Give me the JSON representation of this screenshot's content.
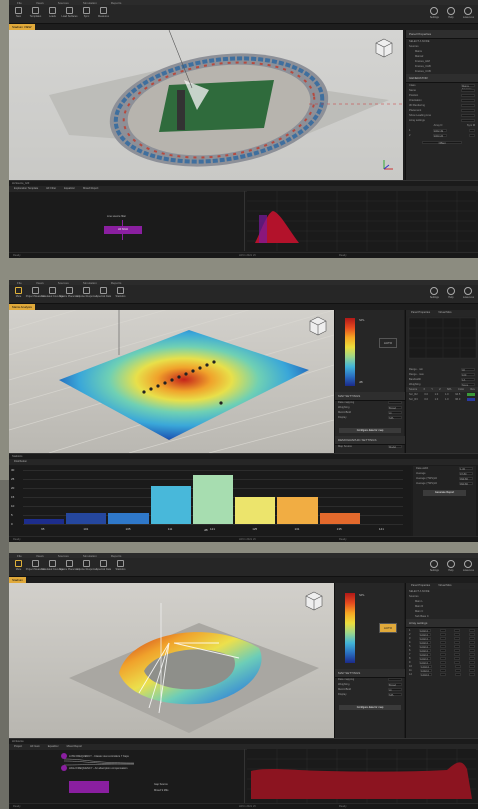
{
  "menu": [
    "File",
    "Views",
    "Sources",
    "Simulation",
    "Reports"
  ],
  "s1": {
    "ribbon": [
      "New",
      "Templates",
      "Loads",
      "Load Surfaces",
      "Sync",
      "Measures"
    ],
    "ribbon_right": [
      "Settings",
      "Help",
      "Lower-res"
    ],
    "viewport_tag": "Stadium VIEW",
    "panel_title": "Panel Properties",
    "props": {
      "group1": "SELECT A NODE",
      "sources": "Sources",
      "items": [
        "Mains",
        "Mains2",
        "Frames_HiM",
        "Frames_CHB",
        "Frames_CUB"
      ],
      "section": "GENERATOR",
      "rows": [
        {
          "label": "Class",
          "value": "Mains Sources"
        },
        {
          "label": "Name",
          "value": ""
        },
        {
          "label": "Position",
          "value": ""
        },
        {
          "label": "Orientation",
          "value": ""
        },
        {
          "label": "3D Rendering",
          "value": ""
        },
        {
          "label": "Placement",
          "value": ""
        },
        {
          "label": "Show Leading Line",
          "value": ""
        },
        {
          "label": "Array settings",
          "value": ""
        }
      ],
      "table_head": [
        "",
        "Array D",
        "Sym M"
      ],
      "table": [
        [
          "1",
          "1002.49",
          "",
          ""
        ],
        [
          "2",
          "1003.26",
          "",
          ""
        ]
      ],
      "foot": "Offset"
    },
    "bottom_tabs": [
      "Exploration Template",
      "HF Filter",
      "Equalizer",
      "Mixed Report"
    ],
    "subtitle": "Hi-Source_GIF",
    "source_label": "Line source filter",
    "purple_label": "HF 60Hz",
    "status_left": "Ready",
    "status_mid": "LRC1 2021 L5",
    "status_right": "Ready"
  },
  "s2": {
    "ribbon": [
      "Mute",
      "Project Measures",
      "Simulated Coverage",
      "Source Placement",
      "Impulse Response",
      "Spectral Data",
      "Statistics"
    ],
    "ribbon_right": [
      "Settings",
      "Help",
      "Lower-res"
    ],
    "viewport_tag": "Mains Analysis",
    "legend_top": "SPL",
    "legend_ticks": [
      "dB"
    ],
    "auto_button": "AUTO",
    "map_title": "MAP SETTINGS",
    "map_rows": [
      {
        "label": "Data mapping",
        "value": ""
      },
      {
        "label": "Weighting",
        "value": "Broad"
      },
      {
        "label": "Metric/Bold",
        "value": "Hi"
      },
      {
        "label": "Display",
        "value": "SPL"
      }
    ],
    "map_button": "Configure data for map",
    "map_title2": "DEMOGRAPHIC SETTINGS",
    "map_row2": {
      "label": "Map Source",
      "value": "Model"
    },
    "panel_tabs": [
      "Panel Properties",
      "Virtual Mics"
    ],
    "side_rows": [
      {
        "label": "Range - min",
        "value": "40"
      },
      {
        "label": "Range - max",
        "value": "100"
      },
      {
        "label": "Bandwidth",
        "value": "1/1"
      },
      {
        "label": "Weighting",
        "value": "None"
      }
    ],
    "side_table_head": [
      "Source",
      "X",
      "Y",
      "Z",
      "SPL",
      "Color",
      "Rev"
    ],
    "side_table": [
      [
        "Src_R2",
        "0.0",
        "1.0",
        "1.0",
        "94.5"
      ],
      [
        "Src_R3",
        "0.0",
        "1.0",
        "1.0",
        "96.0"
      ]
    ],
    "bottom_tabs": [
      "Distribution"
    ],
    "bottom_title": "Statistics",
    "stats": [
      {
        "label": "Data width",
        "value": "1.30"
      },
      {
        "label": "Average",
        "value": "97.80"
      },
      {
        "label": "Average (TWS)Hz",
        "value": "999.80"
      },
      {
        "label": "Average (TWS)Hz",
        "value": "990.80"
      }
    ],
    "stats_button": "Generate Report",
    "status_left": "Ready",
    "status_mid": "LRC1 2021 L5",
    "status_right": "Ready"
  },
  "chart_data": {
    "type": "bar",
    "categories": [
      "95",
      "101",
      "105",
      "111",
      "121",
      "125",
      "131",
      "135",
      "141"
    ],
    "values": [
      1,
      2,
      2,
      7,
      9,
      5,
      5,
      2,
      0
    ],
    "colors": [
      "#1d2d8c",
      "#25479e",
      "#2f78c9",
      "#48b8da",
      "#a7ddb0",
      "#ece46c",
      "#f1ad43",
      "#e3692c",
      "#c52819"
    ],
    "yticks": [
      "30",
      "25",
      "20",
      "15",
      "10",
      "5",
      "0"
    ],
    "ylim": [
      0,
      10
    ],
    "xlabel": "dB",
    "ylabel": ""
  },
  "s3": {
    "ribbon": [
      "Mute",
      "Project Measures",
      "Simulated Coverage",
      "Source Placement",
      "Impulse Response",
      "Spectral Data",
      "Statistics"
    ],
    "ribbon_right": [
      "Settings",
      "Help",
      "Lower-res"
    ],
    "viewport_tag": "Stadium",
    "legend_top": "SPL",
    "auto_button": "AUTO",
    "map_title": "MAP SETTINGS",
    "map_rows": [
      {
        "label": "Data mapping",
        "value": ""
      },
      {
        "label": "Weighting",
        "value": "Broad"
      },
      {
        "label": "Metric/Bold",
        "value": "Hi"
      },
      {
        "label": "Display",
        "value": "SPL"
      }
    ],
    "map_button": "Configure data for map",
    "panel_tabs": [
      "Panel Properties",
      "Virtual Mics"
    ],
    "tree_title": "SELECT A NODE",
    "tree": [
      "Sources",
      "Main L",
      "Main R",
      "Main C",
      "Sub Bass C"
    ],
    "array_title": "Array settings",
    "array_rows": [
      [
        "1",
        "1002.0"
      ],
      [
        "2",
        "1002.0"
      ],
      [
        "3",
        "1002.0"
      ],
      [
        "4",
        "1002.0"
      ],
      [
        "5",
        "1002.0"
      ],
      [
        "6",
        "1002.0"
      ],
      [
        "7",
        "1002.0"
      ],
      [
        "8",
        "1002.0"
      ],
      [
        "9",
        "1002.0"
      ],
      [
        "10",
        "1002.0"
      ],
      [
        "11",
        "1002.0"
      ],
      [
        "12",
        "1002.0"
      ]
    ],
    "bottom_tabs": [
      "Project",
      "HF Gain",
      "Equalizer",
      "Mixed Report"
    ],
    "subtitle": "HI-Source",
    "eq_rows": [
      "LOW FREQUENCY - Classic stat controllers 7 fraps",
      "HIGH FREQUENCY - Air absorption compensation"
    ],
    "eq_buttons": [
      "Gap Source",
      "Mixed 9 Mils"
    ],
    "status_left": "Ready",
    "status_mid": "LRC1 2021 L5",
    "status_right": "Ready"
  }
}
